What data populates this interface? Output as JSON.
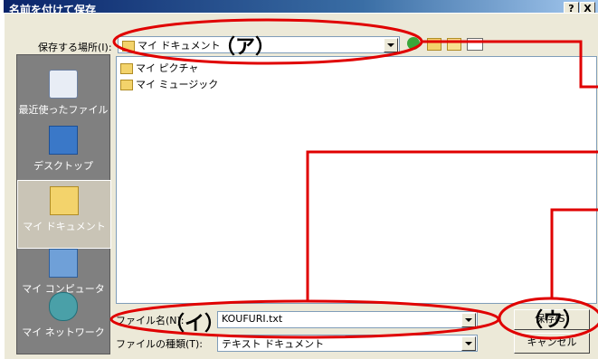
{
  "window": {
    "title": "名前を付けて保存",
    "help": "?",
    "close": "X"
  },
  "toolbar": {
    "save_in_label": "保存する場所(I):",
    "save_in_value": "マイ ドキュメント"
  },
  "places": [
    {
      "label": "最近使ったファイル",
      "icon": "recent-icon"
    },
    {
      "label": "デスクトップ",
      "icon": "desktop-icon"
    },
    {
      "label": "マイ ドキュメント",
      "icon": "my-documents-icon"
    },
    {
      "label": "マイ コンピュータ",
      "icon": "my-computer-icon"
    },
    {
      "label": "マイ ネットワーク",
      "icon": "my-network-icon"
    }
  ],
  "files": [
    {
      "name": "マイ ピクチャ",
      "icon": "folder-icon"
    },
    {
      "name": "マイ ミュージック",
      "icon": "folder-icon"
    }
  ],
  "form": {
    "filename_label": "ファイル名(N):",
    "filename_value": "KOUFURI.txt",
    "filetype_label": "ファイルの種類(T):",
    "filetype_value": "テキスト ドキュメント"
  },
  "buttons": {
    "save": "保存(S)",
    "cancel": "キャンセル"
  },
  "annotations": {
    "a": "（ア）",
    "i": "（イ）",
    "u": "（ウ）"
  },
  "colors": {
    "annotation_red": "#e00000"
  }
}
